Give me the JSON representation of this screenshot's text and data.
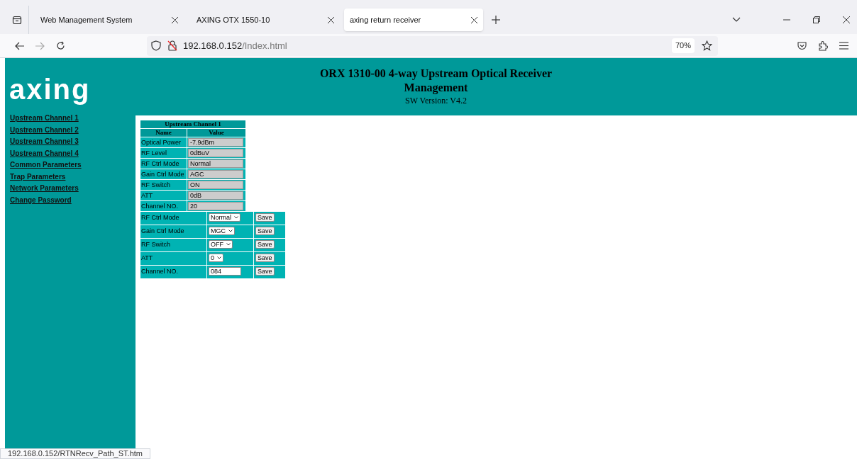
{
  "browser": {
    "tabs": [
      {
        "title": "Web Management System",
        "selected": false
      },
      {
        "title": "AXING OTX 1550-10",
        "selected": false
      },
      {
        "title": "axing return receiver",
        "selected": true
      }
    ],
    "address": {
      "host": "192.168.0.152",
      "path": "/Index.html"
    },
    "zoom": "70%"
  },
  "header": {
    "logo": "axing",
    "title": "ORX 1310-00 4-way Upstream Optical Receiver Management",
    "version": "SW Version: V4.2"
  },
  "sidebar": {
    "items": [
      "Upstream Channel 1",
      "Upstream Channel 2",
      "Upstream Channel 3",
      "Upstream Channel 4",
      "Common Parameters",
      "Trap Parameters",
      "Network Parameters",
      "Change Password"
    ]
  },
  "status_table": {
    "title": "Upstream Channel 1",
    "columns": [
      "Name",
      "Value"
    ],
    "rows": [
      {
        "name": "Optical Power",
        "value": "-7.9dBm"
      },
      {
        "name": "RF Level",
        "value": "0dBuV"
      },
      {
        "name": "RF Ctrl Mode",
        "value": "Normal"
      },
      {
        "name": "Gain Ctrl Mode",
        "value": "AGC"
      },
      {
        "name": "RF Switch",
        "value": "ON"
      },
      {
        "name": "ATT",
        "value": "0dB"
      },
      {
        "name": "Channel NO.",
        "value": "20"
      }
    ]
  },
  "settings_table": {
    "rows": [
      {
        "label": "RF Ctrl Mode",
        "kind": "select",
        "value": "Normal",
        "button": "Save"
      },
      {
        "label": "Gain Ctrl Mode",
        "kind": "select",
        "value": "MGC",
        "button": "Save"
      },
      {
        "label": "RF Switch",
        "kind": "select",
        "value": "OFF",
        "button": "Save"
      },
      {
        "label": "ATT",
        "kind": "select",
        "value": "0",
        "button": "Save"
      },
      {
        "label": "Channel NO.",
        "kind": "input",
        "value": "084",
        "button": "Save"
      }
    ]
  },
  "status_bar": {
    "link": "192.168.0.152/RTNRecv_Path_ST.htm"
  }
}
